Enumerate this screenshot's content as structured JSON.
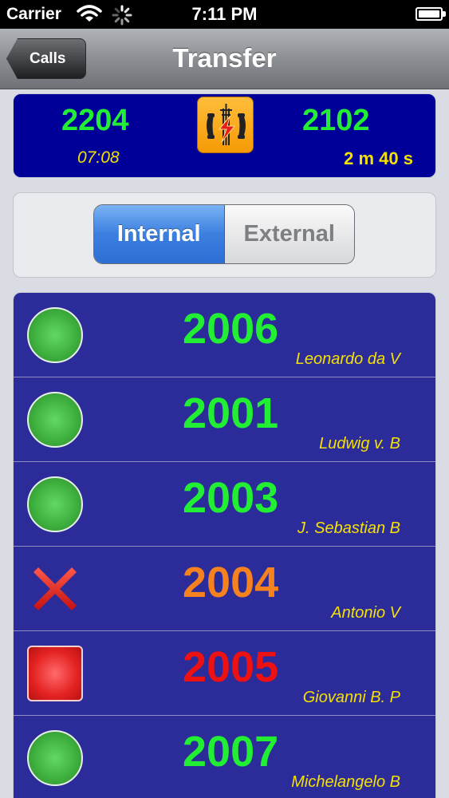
{
  "status_bar": {
    "carrier": "Carrier",
    "time": "7:11 PM"
  },
  "nav": {
    "back_label": "Calls",
    "title": "Transfer"
  },
  "call": {
    "from_extension": "2204",
    "start_time": "07:08",
    "to_extension": "2102",
    "duration": "2 m 40 s"
  },
  "segment": {
    "options": [
      "Internal",
      "External"
    ],
    "selected": "Internal"
  },
  "extensions": [
    {
      "number": "2006",
      "name": "Leonardo da V",
      "status": "available",
      "color": "#22ee33"
    },
    {
      "number": "2001",
      "name": "Ludwig v. B",
      "status": "available",
      "color": "#22ee33"
    },
    {
      "number": "2003",
      "name": "J. Sebastian B",
      "status": "available",
      "color": "#22ee33"
    },
    {
      "number": "2004",
      "name": "Antonio V",
      "status": "unavailable",
      "color": "#f5811f"
    },
    {
      "number": "2005",
      "name": "Giovanni B. P",
      "status": "busy",
      "color": "#ee1111"
    },
    {
      "number": "2007",
      "name": "Michelangelo B",
      "status": "available",
      "color": "#22ee33"
    }
  ],
  "colors": {
    "panel_bg": "#000099",
    "list_bg": "#2b2b9a",
    "label_yellow": "#f5e100",
    "available_green": "#22ee33",
    "unavailable_orange": "#f5811f",
    "busy_red": "#ee1111"
  }
}
